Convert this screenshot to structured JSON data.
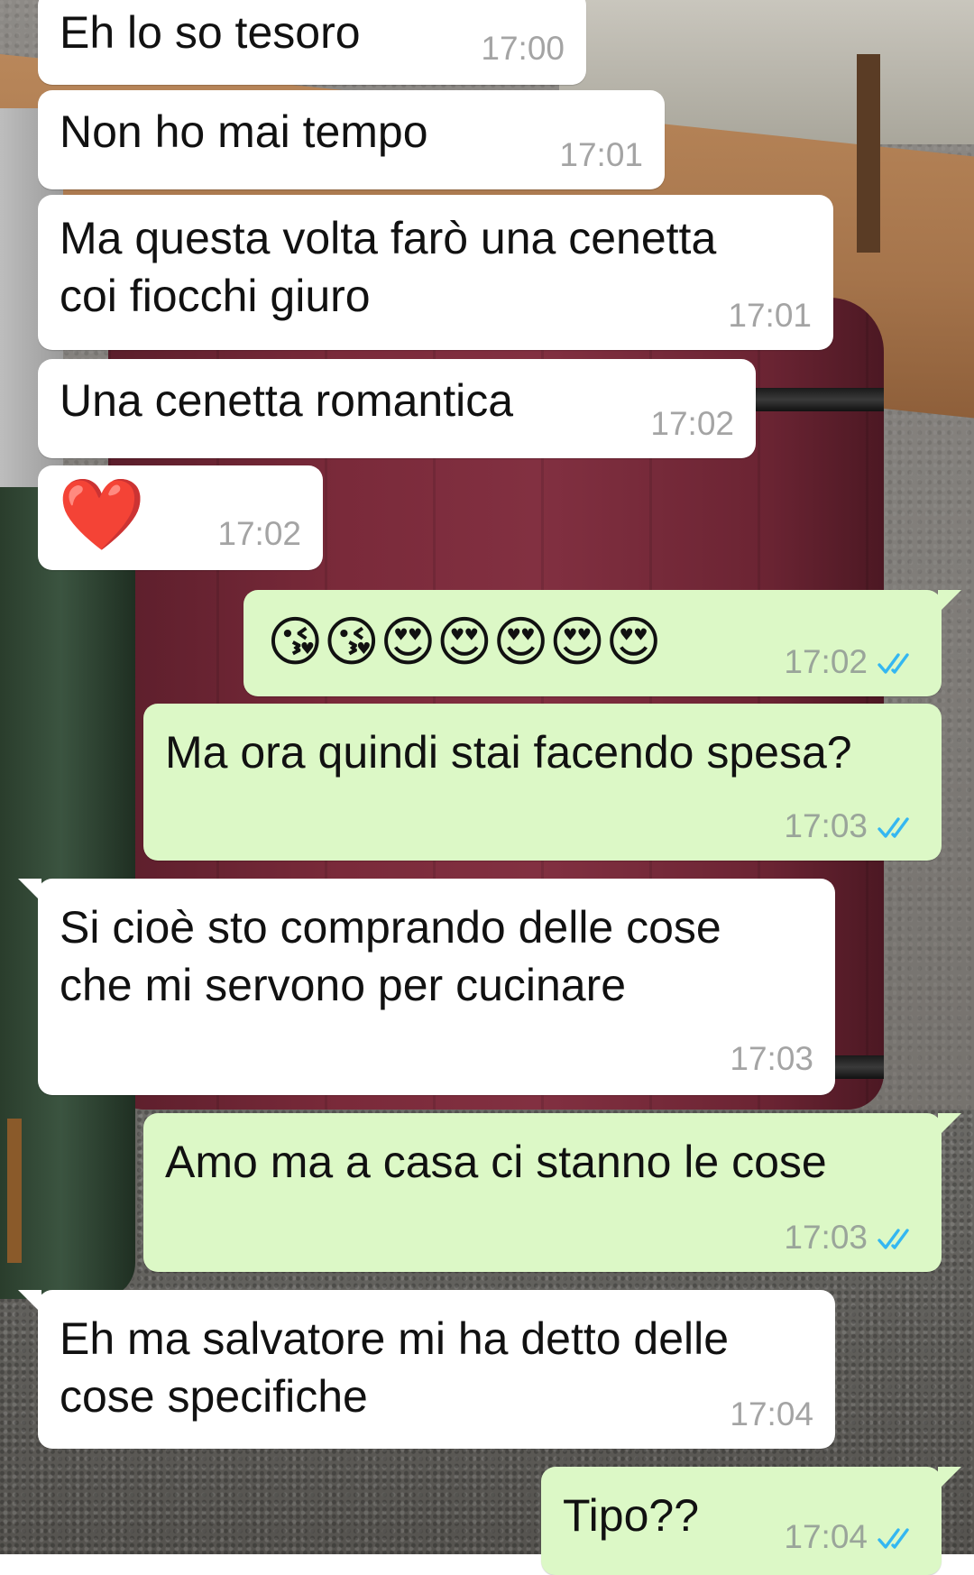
{
  "messages": [
    {
      "id": "m1",
      "side": "in",
      "text": "Eh lo so tesoro",
      "time": "17:00"
    },
    {
      "id": "m2",
      "side": "in",
      "text": "Non ho mai tempo",
      "time": "17:01"
    },
    {
      "id": "m3",
      "side": "in",
      "text": "Ma questa volta farò una cenetta\ncoi fiocchi giuro",
      "time": "17:01"
    },
    {
      "id": "m4",
      "side": "in",
      "text": "Una cenetta romantica",
      "time": "17:02"
    },
    {
      "id": "m5",
      "side": "in",
      "text": "❤️",
      "time": "17:02"
    },
    {
      "id": "m6",
      "side": "out",
      "text": "😘😘😍😍😍😍😍",
      "time": "17:02",
      "status": "read"
    },
    {
      "id": "m7",
      "side": "out",
      "text": "Ma ora quindi stai facendo spesa?",
      "time": "17:03",
      "status": "read"
    },
    {
      "id": "m8",
      "side": "in",
      "text": "Si cioè sto comprando delle cose\nche mi servono per cucinare",
      "time": "17:03"
    },
    {
      "id": "m9",
      "side": "out",
      "text": "Amo ma a casa ci stanno le cose",
      "time": "17:03",
      "status": "read"
    },
    {
      "id": "m10",
      "side": "in",
      "text": "Eh ma salvatore mi ha detto delle\ncose specifiche",
      "time": "17:04"
    },
    {
      "id": "m11",
      "side": "out",
      "text": "Tipo??",
      "time": "17:04",
      "status": "read"
    }
  ],
  "icons": {
    "read_receipt": "double-check-icon"
  },
  "colors": {
    "incoming_bubble": "#ffffff",
    "outgoing_bubble": "#dcf8c6",
    "read_tick": "#34b7f1",
    "timestamp": "#a4a4a4"
  }
}
